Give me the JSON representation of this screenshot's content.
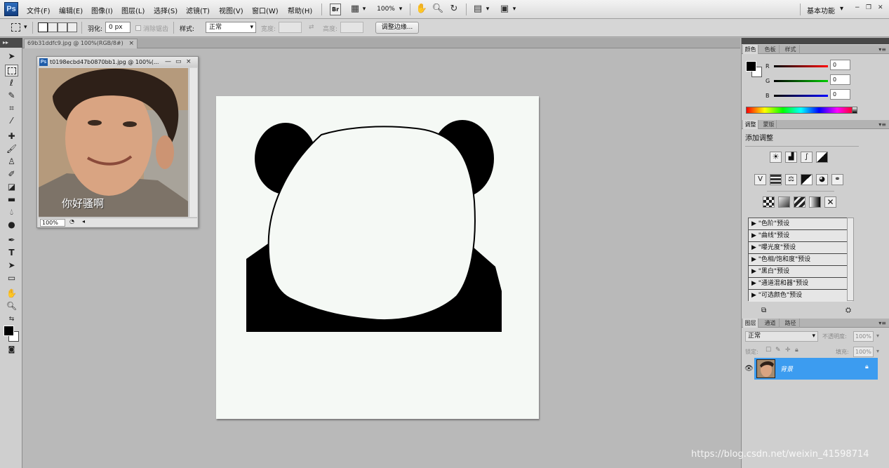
{
  "app": {
    "logo": "Ps"
  },
  "menubar": {
    "items": [
      "文件(F)",
      "编辑(E)",
      "图像(I)",
      "图层(L)",
      "选择(S)",
      "滤镜(T)",
      "视图(V)",
      "窗口(W)",
      "帮助(H)"
    ],
    "bridge_label": "Br",
    "zoom_select": "100%",
    "workspace": "基本功能",
    "workspace_arrow": "▾"
  },
  "options_bar": {
    "feather_label": "羽化:",
    "feather_value": "0 px",
    "antialias_label": "消除锯齿",
    "style_label": "样式:",
    "style_value": "正常",
    "width_label": "宽度:",
    "height_label": "高度:",
    "refine_button": "调整边缘..."
  },
  "tabs": {
    "active_doc": "69b31ddfc9.jpg @ 100%(RGB/8#)",
    "active_close": "×"
  },
  "floating_window": {
    "title": "t0198ecbd47b0870bb1.jpg @ 100%(...",
    "minimize": "—",
    "maximize": "▭",
    "close": "×",
    "caption": "你好骚啊",
    "zoom": "100%"
  },
  "panels": {
    "color_tabs": [
      "颜色",
      "色板",
      "样式"
    ],
    "channels": [
      {
        "label": "R",
        "value": "0"
      },
      {
        "label": "G",
        "value": "0"
      },
      {
        "label": "B",
        "value": "0"
      }
    ],
    "adjust_tabs": [
      "调整",
      "蒙版"
    ],
    "adjust_title": "添加调整",
    "presets": [
      "\"色阶\"预设",
      "\"曲线\"预设",
      "\"曝光度\"预设",
      "\"色相/饱和度\"预设",
      "\"黑白\"预设",
      "\"通道混和器\"预设",
      "\"可选颜色\"预设"
    ],
    "layer_tabs": [
      "图层",
      "通道",
      "路径"
    ],
    "blend_mode": "正常",
    "opacity_label": "不透明度:",
    "opacity_value": "100%",
    "lock_label": "锁定:",
    "fill_label": "填充:",
    "fill_value": "100%",
    "layer_name": "背景",
    "panel_menu": "▾≡"
  },
  "colors": {
    "accent": "#3c9cf0",
    "canvas": "#b9b9b9",
    "document": "#f5f9f5"
  },
  "watermark": "https://blog.csdn.net/weixin_41598714"
}
